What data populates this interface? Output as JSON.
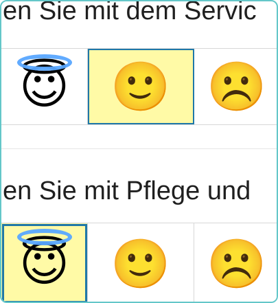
{
  "questions": [
    {
      "text": "en Sie mit dem Servic",
      "options": [
        {
          "name": "angel",
          "glyph": "😇"
        },
        {
          "name": "slight-smile",
          "glyph": "🙂"
        },
        {
          "name": "frown",
          "glyph": "☹️"
        }
      ],
      "selected_index": 1
    },
    {
      "text": "en Sie mit Pflege und",
      "options": [
        {
          "name": "angel",
          "glyph": "😇"
        },
        {
          "name": "slight-smile",
          "glyph": "🙂"
        },
        {
          "name": "frown",
          "glyph": "☹️"
        }
      ],
      "selected_index": 0
    }
  ],
  "colors": {
    "frame_border": "#64c7c9",
    "selected_bg": "#fffaa6",
    "selected_border": "#1f78a8",
    "grid": "#d7d7d7"
  }
}
